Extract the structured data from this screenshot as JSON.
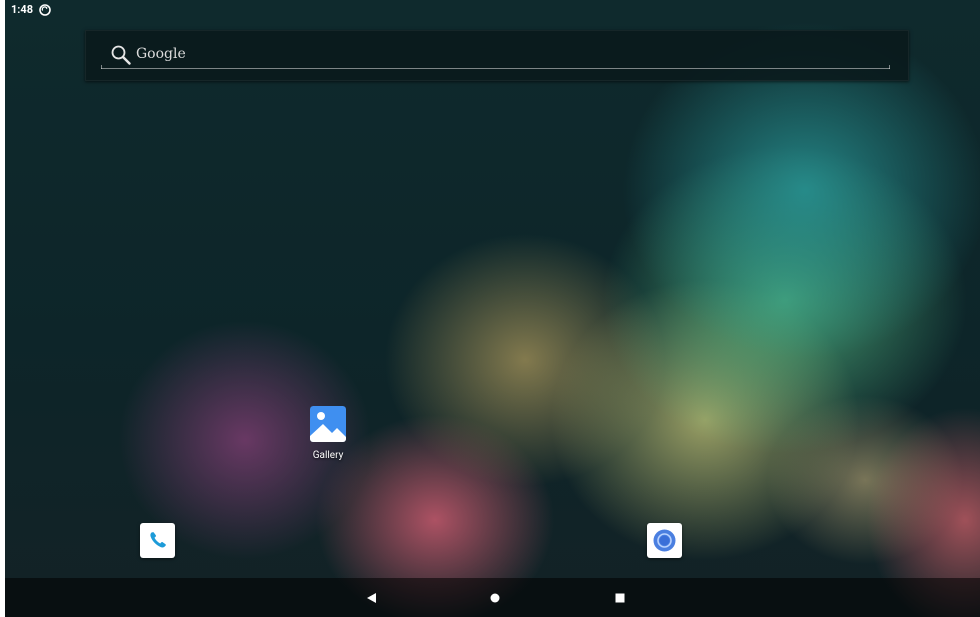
{
  "status_bar": {
    "time": "1:48",
    "sync_icon": "sync-icon"
  },
  "search": {
    "label": "Google",
    "icon": "search-icon"
  },
  "apps": {
    "gallery": {
      "label": "Gallery",
      "icon": "gallery-icon"
    },
    "phone": {
      "icon": "phone-icon"
    },
    "browser": {
      "icon": "browser-icon"
    }
  },
  "nav": {
    "back": "back-icon",
    "home": "home-icon",
    "recents": "recents-icon"
  },
  "colors": {
    "gallery_blue": "#3f8ff0",
    "phone_blue": "#1d9bd8",
    "browser_blue": "#4a7fe0"
  }
}
